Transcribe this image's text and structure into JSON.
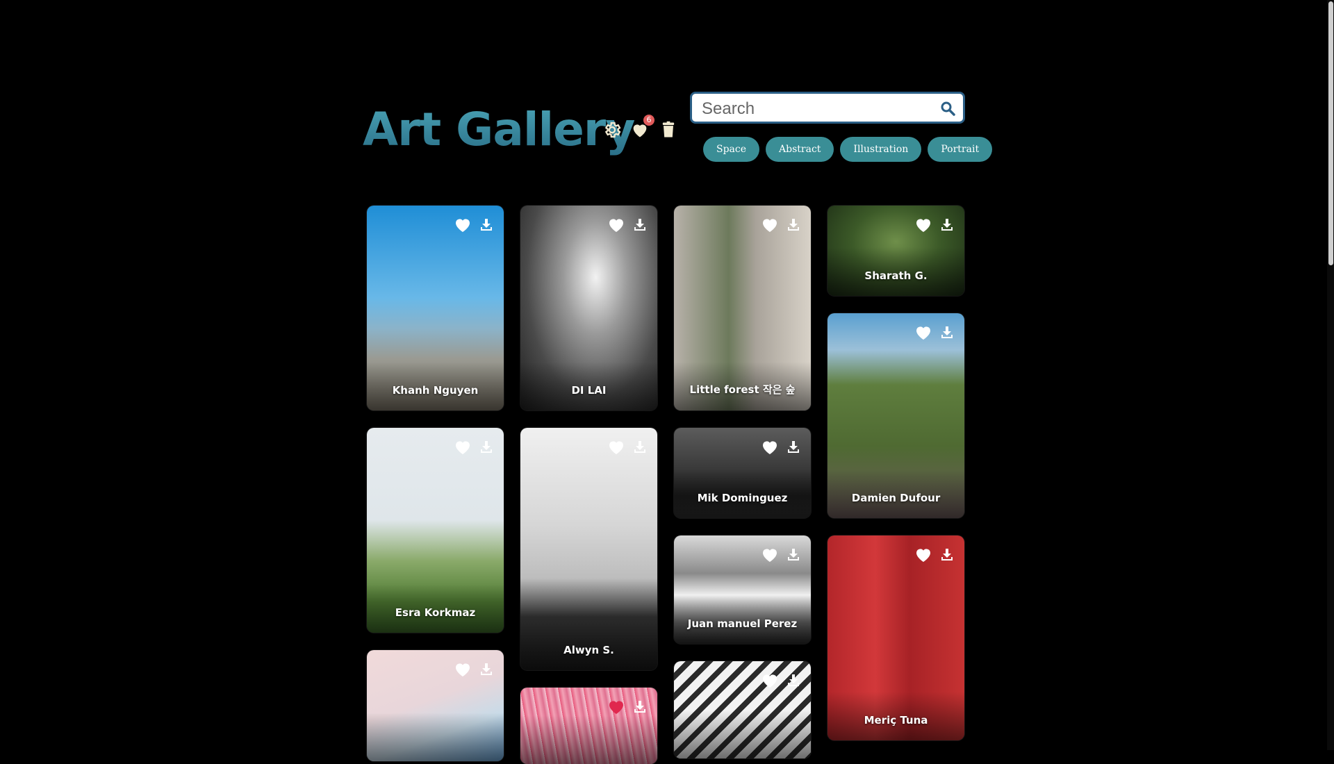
{
  "header": {
    "title": "Art Gallery",
    "favorites_count": "6"
  },
  "search": {
    "placeholder": "Search",
    "value": ""
  },
  "tags": [
    "Space",
    "Abstract",
    "Illustration",
    "Portrait"
  ],
  "colors": {
    "accent": "#3a8e96",
    "title_gradient": [
      "#4aa3b5",
      "#2a6f88"
    ],
    "search_border": "#2b5f86",
    "liked": "#e0284f"
  },
  "cards": [
    {
      "author": "Khanh Nguyen",
      "liked": false
    },
    {
      "author": "DI LAI",
      "liked": false
    },
    {
      "author": "Little forest 작은 숲",
      "liked": false
    },
    {
      "author": "Sharath G.",
      "liked": false
    },
    {
      "author": "Damien Dufour",
      "liked": false
    },
    {
      "author": "Esra Korkmaz",
      "liked": false
    },
    {
      "author": "Alwyn S.",
      "liked": false
    },
    {
      "author": "Mik Dominguez",
      "liked": false
    },
    {
      "author": "Juan manuel Perez",
      "liked": false
    },
    {
      "author": "Meriç Tuna",
      "liked": false
    },
    {
      "author": "",
      "liked": false
    },
    {
      "author": "",
      "liked": true
    },
    {
      "author": "",
      "liked": false
    }
  ]
}
